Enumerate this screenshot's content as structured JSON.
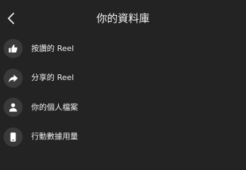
{
  "header": {
    "title": "你的資料庫",
    "back_icon": "chevron-left-icon"
  },
  "menu": {
    "items": [
      {
        "label": "按讚的 Reel",
        "icon": "thumbs-up-icon"
      },
      {
        "label": "分享的 Reel",
        "icon": "share-arrow-icon"
      },
      {
        "label": "你的個人檔案",
        "icon": "person-icon"
      },
      {
        "label": "行動數據用量",
        "icon": "phone-icon"
      }
    ]
  },
  "colors": {
    "background": "#232323",
    "icon_circle": "#3a3a3a",
    "text": "#f0f0f0"
  }
}
